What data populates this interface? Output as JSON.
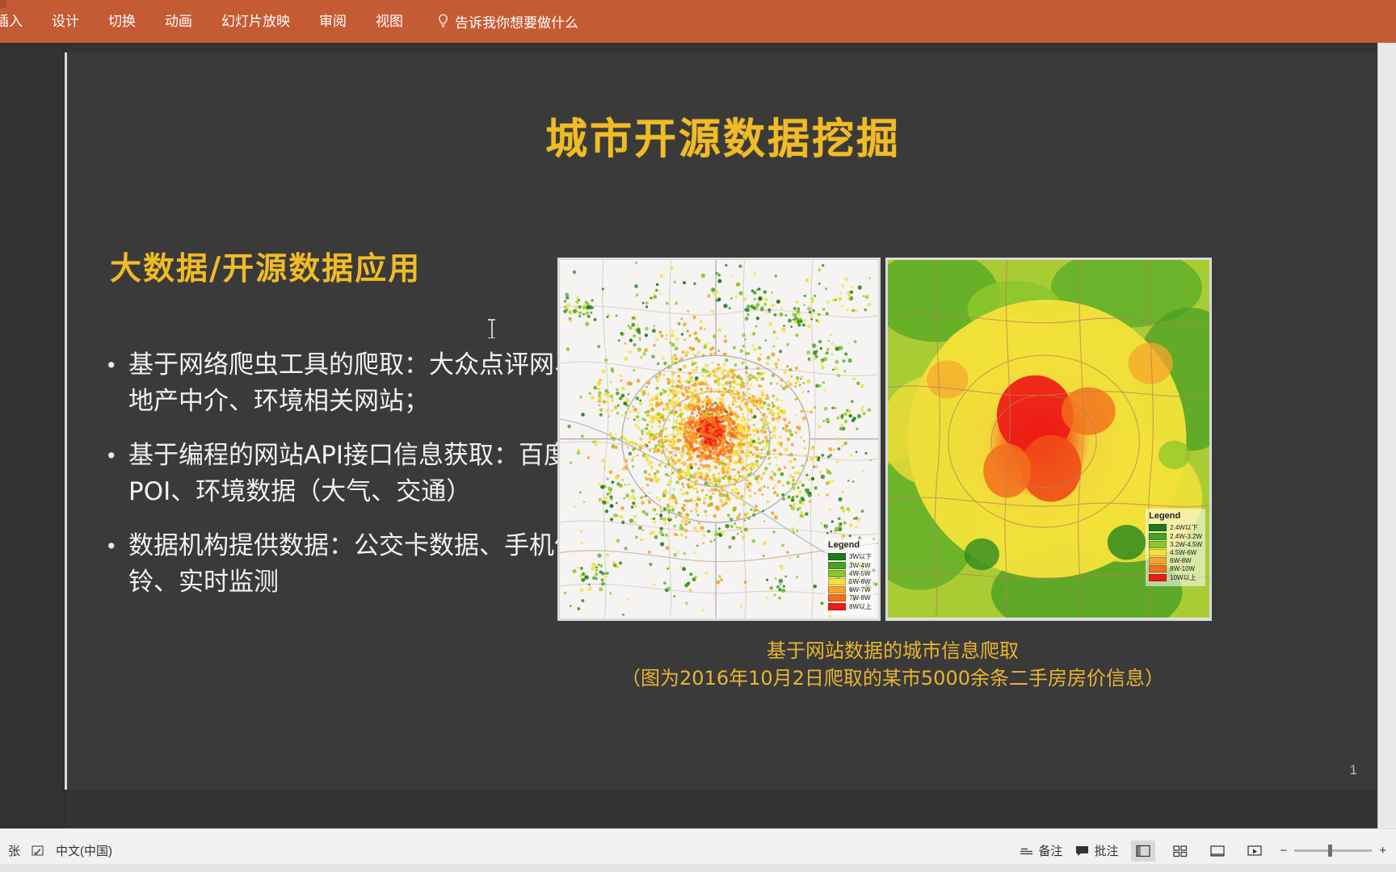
{
  "ribbon": {
    "tabs": [
      {
        "label": "插入"
      },
      {
        "label": "设计"
      },
      {
        "label": "切换"
      },
      {
        "label": "动画"
      },
      {
        "label": "幻灯片放映"
      },
      {
        "label": "审阅"
      },
      {
        "label": "视图"
      }
    ],
    "tell_me": "告诉我你想要做什么",
    "bulb_icon": "lightbulb-icon"
  },
  "slide": {
    "title": "城市开源数据挖掘",
    "subtitle": "大数据/开源数据应用",
    "bullet_marker": "•",
    "bullets": [
      "基于网络爬虫工具的爬取：大众点评网、房地产中介、环境相关网站；",
      "基于编程的网站API接口信息获取：百度POI、环境数据（大气、交通）",
      "数据机构提供数据：公交卡数据、手机信铃、实时监测"
    ],
    "caption_line1": "基于网站数据的城市信息爬取",
    "caption_line2": "（图为2016年10月2日爬取的某市5000余条二手房房价信息）",
    "slide_number": "1",
    "colors": {
      "accent_gold": "#f0bb27",
      "background": "#3a3a3a",
      "body_text": "#f2f2f2",
      "caption": "#e8b531",
      "ribbon": "#c55b34"
    }
  },
  "maps": {
    "left": {
      "name": "point-scatter-map",
      "legend_title": "Legend",
      "legend": [
        {
          "label": "3W以下",
          "color": "#1f7a1f"
        },
        {
          "label": "3W-4W",
          "color": "#4aa024"
        },
        {
          "label": "4W-5W",
          "color": "#8cc62b"
        },
        {
          "label": "5W-6W",
          "color": "#f2e13a"
        },
        {
          "label": "6W-7W",
          "color": "#f7a52a"
        },
        {
          "label": "7W-8W",
          "color": "#f36f1c"
        },
        {
          "label": "8W以上",
          "color": "#ee1c16"
        }
      ]
    },
    "right": {
      "name": "heatmap-interpolation-map",
      "legend_title": "Legend",
      "legend": [
        {
          "label": "2.4W以下",
          "color": "#1f7a1f"
        },
        {
          "label": "2.4W-3.2W",
          "color": "#4aa024"
        },
        {
          "label": "3.2W-4.5W",
          "color": "#8cc62b"
        },
        {
          "label": "4.5W-6W",
          "color": "#f2e13a"
        },
        {
          "label": "6W-8W",
          "color": "#f7a52a"
        },
        {
          "label": "8W-10W",
          "color": "#f36f1c"
        },
        {
          "label": "10W以上",
          "color": "#ee1c16"
        }
      ]
    }
  },
  "status": {
    "slide_count": "张",
    "language": "中文(中国)",
    "notes_label": "备注",
    "comments_label": "批注",
    "zoom_minus": "−",
    "zoom_plus": "+",
    "spell_icon": "spellcheck-icon",
    "notes_icon": "notes-icon",
    "comments_icon": "comment-icon",
    "view_normal_icon": "normal-view-icon",
    "view_sorter_icon": "slide-sorter-icon",
    "view_reading_icon": "reading-view-icon",
    "view_show_icon": "slideshow-icon",
    "fit_icon": "fit-slide-icon"
  }
}
